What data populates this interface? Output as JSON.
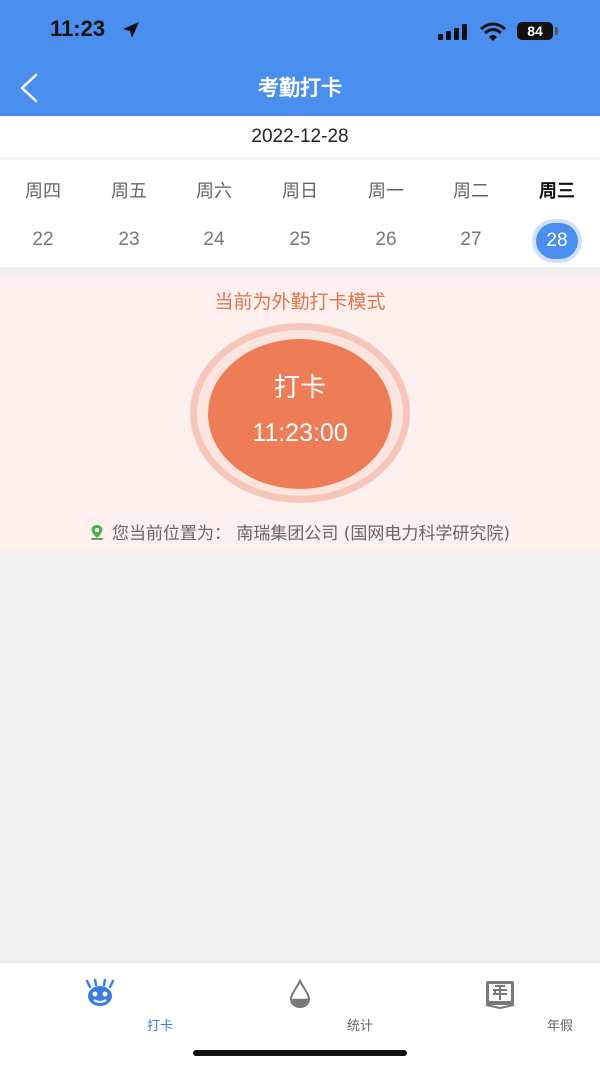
{
  "status": {
    "time": "11:23",
    "battery": "84"
  },
  "nav": {
    "title": "考勤打卡"
  },
  "date": "2022-12-28",
  "week": [
    {
      "weekday": "周四",
      "day": "22",
      "active": false
    },
    {
      "weekday": "周五",
      "day": "23",
      "active": false
    },
    {
      "weekday": "周六",
      "day": "24",
      "active": false
    },
    {
      "weekday": "周日",
      "day": "25",
      "active": false
    },
    {
      "weekday": "周一",
      "day": "26",
      "active": false
    },
    {
      "weekday": "周二",
      "day": "27",
      "active": false
    },
    {
      "weekday": "周三",
      "day": "28",
      "active": true
    }
  ],
  "checkin": {
    "mode_text": "当前为外勤打卡模式",
    "button_label": "打卡",
    "time": "11:23:00",
    "location": "您当前位置为：  南瑞集团公司 (国网电力科学研究院)"
  },
  "tabs": [
    {
      "label": "打卡",
      "icon": "check-in-icon",
      "active": true
    },
    {
      "label": "统计",
      "icon": "statistics-drop-icon",
      "active": false
    },
    {
      "label": "年假",
      "icon": "annual-leave-icon",
      "active": false
    }
  ],
  "colors": {
    "primary": "#4a8ef0",
    "accent": "#ee7c56",
    "panel_bg": "#fdf0ee",
    "page_bg": "#f0f0f0"
  }
}
